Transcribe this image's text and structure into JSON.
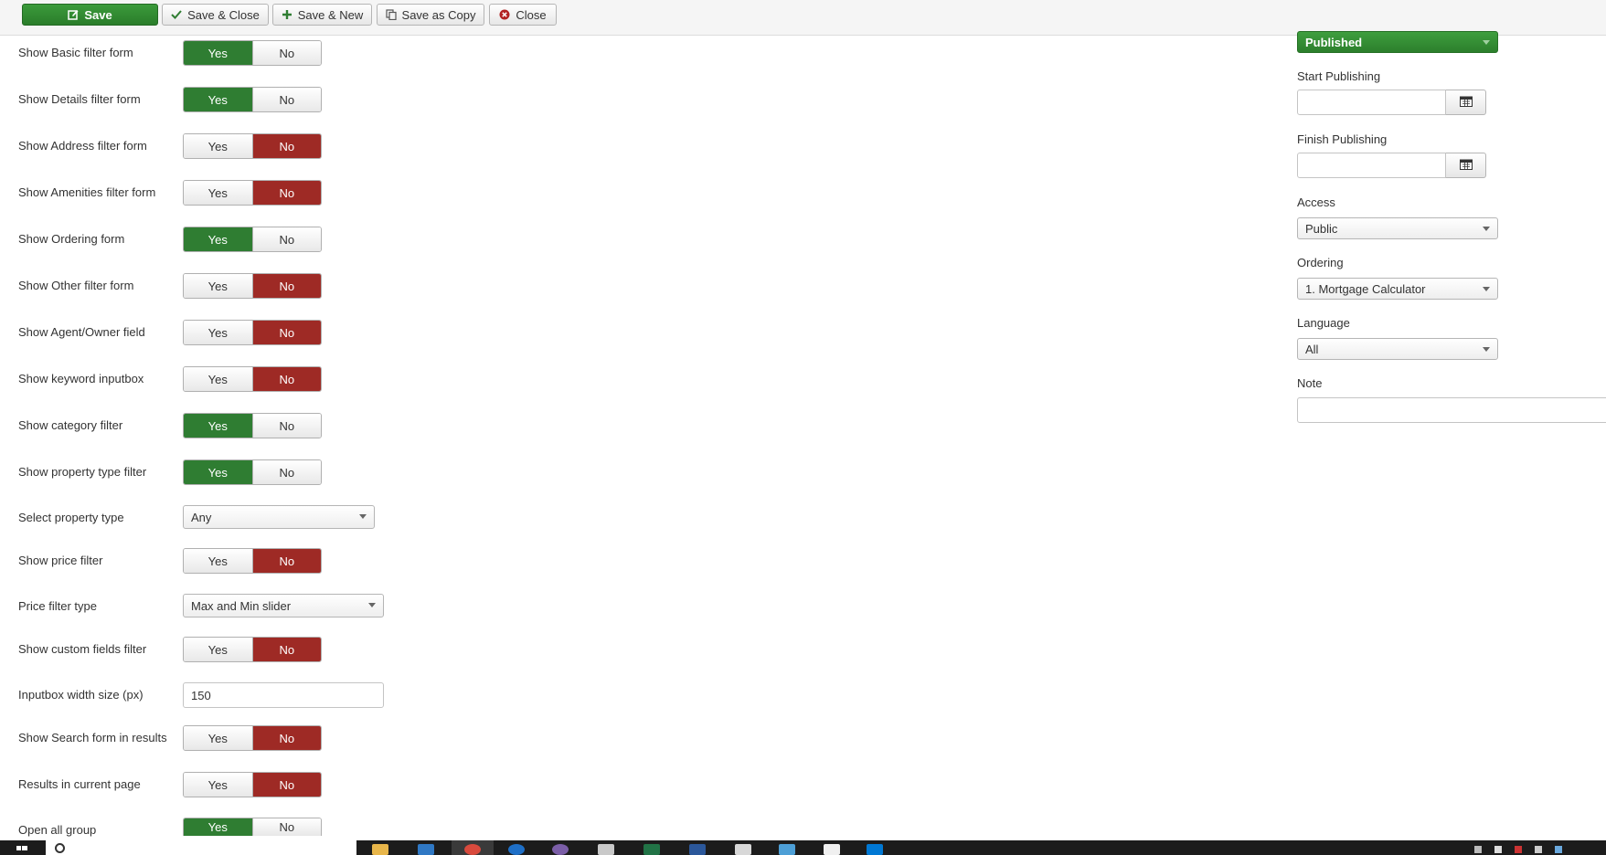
{
  "toolbar": {
    "save": "Save",
    "save_close": "Save & Close",
    "save_new": "Save & New",
    "save_copy": "Save as Copy",
    "close": "Close"
  },
  "toggle_labels": {
    "yes": "Yes",
    "no": "No"
  },
  "fields": [
    {
      "label": "Show Basic filter form",
      "type": "toggle",
      "value": "Yes"
    },
    {
      "label": "Show Details filter form",
      "type": "toggle",
      "value": "Yes"
    },
    {
      "label": "Show Address filter form",
      "type": "toggle",
      "value": "No"
    },
    {
      "label": "Show Amenities filter form",
      "type": "toggle",
      "value": "No"
    },
    {
      "label": "Show Ordering form",
      "type": "toggle",
      "value": "Yes"
    },
    {
      "label": "Show Other filter form",
      "type": "toggle",
      "value": "No"
    },
    {
      "label": "Show Agent/Owner field",
      "type": "toggle",
      "value": "No"
    },
    {
      "label": "Show keyword inputbox",
      "type": "toggle",
      "value": "No"
    },
    {
      "label": "Show category filter",
      "type": "toggle",
      "value": "Yes"
    },
    {
      "label": "Show property type filter",
      "type": "toggle",
      "value": "Yes"
    },
    {
      "label": "Select property type",
      "type": "select",
      "value": "Any"
    },
    {
      "label": "Show price filter",
      "type": "toggle",
      "value": "No"
    },
    {
      "label": "Price filter type",
      "type": "select",
      "value": "Max and Min slider"
    },
    {
      "label": "Show custom fields filter",
      "type": "toggle",
      "value": "No"
    },
    {
      "label": "Inputbox width size (px)",
      "type": "text",
      "value": "150"
    },
    {
      "label": "Show Search form in results",
      "type": "toggle",
      "value": "No"
    },
    {
      "label": "Results in current page",
      "type": "toggle",
      "value": "No"
    },
    {
      "label": "Open all group",
      "type": "toggle",
      "value": "Yes"
    }
  ],
  "sidebar": {
    "status": "Published",
    "start_publishing_label": "Start Publishing",
    "start_publishing_value": "",
    "finish_publishing_label": "Finish Publishing",
    "finish_publishing_value": "",
    "access_label": "Access",
    "access_value": "Public",
    "ordering_label": "Ordering",
    "ordering_value": "1. Mortgage Calculator",
    "language_label": "Language",
    "language_value": "All",
    "note_label": "Note",
    "note_value": ""
  },
  "colors": {
    "yes_active": "#2f7d32",
    "no_active": "#9e2a25",
    "status_green": "#2c7f2c",
    "taskbar": "#1c1c1c"
  },
  "taskbar": {
    "icons": [
      "start-icon",
      "search-icon",
      "file-explorer-icon",
      "browser-icon",
      "chrome-icon",
      "edge-icon",
      "app-icon",
      "app-icon",
      "excel-icon",
      "word-icon",
      "app-icon",
      "app-icon",
      "app-icon",
      "app-icon"
    ]
  }
}
